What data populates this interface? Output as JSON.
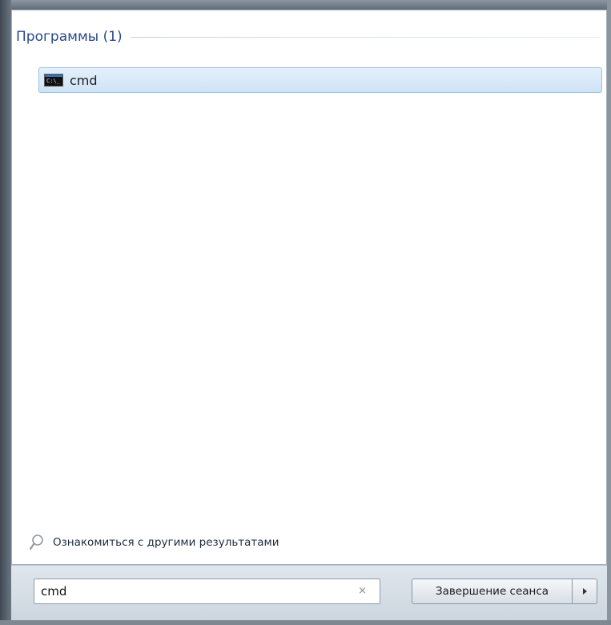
{
  "results": {
    "section_title": "Программы (1)",
    "items": [
      {
        "label": "cmd",
        "icon": "cmd-icon",
        "icon_text": "C:\\_"
      }
    ]
  },
  "more_results": {
    "label": "Ознакомиться с другими результатами",
    "icon": "magnify-icon"
  },
  "search": {
    "value": "cmd",
    "clear_symbol": "×"
  },
  "shutdown": {
    "label": "Завершение сеанса",
    "arrow_icon": "arrow-right-icon"
  },
  "colors": {
    "section_title": "#2a4a8a",
    "selection_bg": "#cfe3f6",
    "selection_border": "#9cc0e3",
    "bottom_strip": "#d6dee6"
  }
}
